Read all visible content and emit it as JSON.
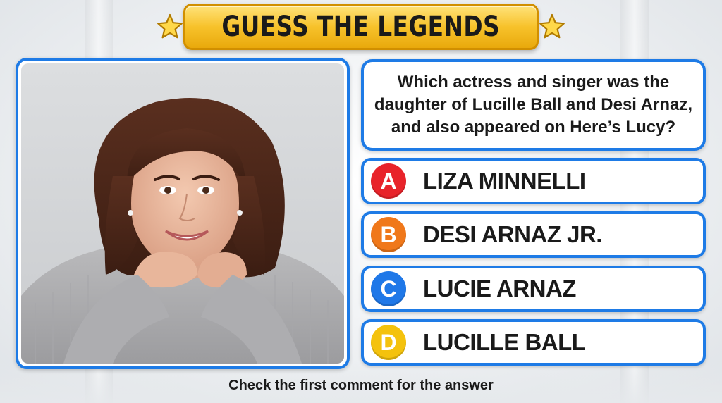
{
  "title": {
    "text": "GUESS THE LEGENDS",
    "left_icon": "star-icon",
    "right_icon": "star-icon"
  },
  "photo": {
    "subject": "portrait-photo"
  },
  "question": {
    "text": "Which actress and singer was the daughter of Lucille Ball and Desi Arnaz, and also appeared on Here’s Lucy?"
  },
  "answers": [
    {
      "letter": "A",
      "text": "LIZA MINNELLI",
      "color": "#e8232a"
    },
    {
      "letter": "B",
      "text": "DESI ARNAZ JR.",
      "color": "#f0781a"
    },
    {
      "letter": "C",
      "text": "LUCIE ARNAZ",
      "color": "#1f78e8"
    },
    {
      "letter": "D",
      "text": "LUCILLE BALL",
      "color": "#f4c20d"
    }
  ],
  "footer": {
    "text": "Check the first comment for the answer"
  },
  "colors": {
    "frame": "#1e7be6",
    "banner": "#f7c22b"
  }
}
